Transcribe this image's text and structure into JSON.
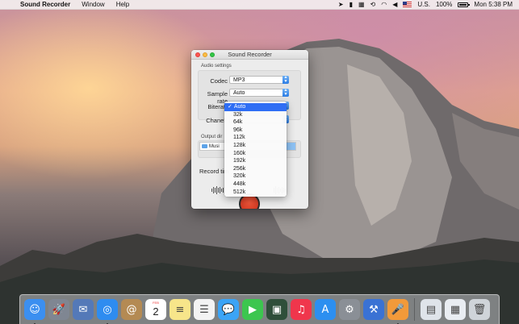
{
  "menubar": {
    "app_name": "Sound Recorder",
    "items": [
      "Window",
      "Help"
    ],
    "status": {
      "battery": "100%",
      "input_source": "U.S.",
      "clock": "Mon 5:38 PM"
    }
  },
  "window": {
    "title": "Sound Recorder",
    "audio_settings_label": "Audio settings",
    "codec_label": "Codec",
    "codec_value": "MP3",
    "sample_rate_label": "Sample rate",
    "sample_rate_value": "Auto",
    "bitrate_label": "Biterat",
    "channels_label": "Chanel",
    "output_dir_label": "Output dir",
    "output_path": "Musi",
    "record_time_label": "Record tim"
  },
  "bitrate_menu": {
    "options": [
      "Auto",
      "32k",
      "64k",
      "96k",
      "112k",
      "128k",
      "160k",
      "192k",
      "256k",
      "320k",
      "448k",
      "512k"
    ],
    "selected": "Auto"
  },
  "dock": {
    "apps": [
      {
        "name": "finder-icon",
        "color": "#3b8ff0",
        "glyph": "☺",
        "running": true
      },
      {
        "name": "launchpad-icon",
        "color": "#7f8692",
        "glyph": "🚀",
        "running": false
      },
      {
        "name": "preview-icon",
        "color": "#5479b8",
        "glyph": "✉",
        "running": false
      },
      {
        "name": "safari-icon",
        "color": "#2e8cf0",
        "glyph": "◎",
        "running": true
      },
      {
        "name": "contacts-icon",
        "color": "#b48a53",
        "glyph": "@",
        "running": false
      },
      {
        "name": "calendar-icon",
        "color": "#ffffff",
        "glyph": "",
        "running": false
      },
      {
        "name": "notes-icon",
        "color": "#f7e58a",
        "glyph": "≡",
        "running": false
      },
      {
        "name": "reminders-icon",
        "color": "#f3f3f3",
        "glyph": "☰",
        "running": false
      },
      {
        "name": "messages-icon",
        "color": "#3ba4f6",
        "glyph": "💬",
        "running": false
      },
      {
        "name": "facetime-icon",
        "color": "#3cc64f",
        "glyph": "▶",
        "running": false
      },
      {
        "name": "photo-booth-icon",
        "color": "#2f4f3a",
        "glyph": "▣",
        "running": false
      },
      {
        "name": "itunes-icon",
        "color": "#f0364c",
        "glyph": "♫",
        "running": false
      },
      {
        "name": "app-store-icon",
        "color": "#2c8ff0",
        "glyph": "A",
        "running": false
      },
      {
        "name": "system-preferences-icon",
        "color": "#8a8f96",
        "glyph": "⚙",
        "running": false
      },
      {
        "name": "xcode-icon",
        "color": "#3a72d4",
        "glyph": "⚒",
        "running": false
      },
      {
        "name": "sound-recorder-icon",
        "color": "#f29a3a",
        "glyph": "🎤",
        "running": true
      }
    ],
    "right_items": [
      {
        "name": "downloads-stack-icon",
        "color": "#dfe4ea",
        "glyph": "▤"
      },
      {
        "name": "documents-stack-icon",
        "color": "#e9edf2",
        "glyph": "▦"
      },
      {
        "name": "trash-icon",
        "color": "#cfd4d9",
        "glyph": "🗑"
      }
    ],
    "calendar": {
      "month": "FEB",
      "day": "2"
    }
  }
}
